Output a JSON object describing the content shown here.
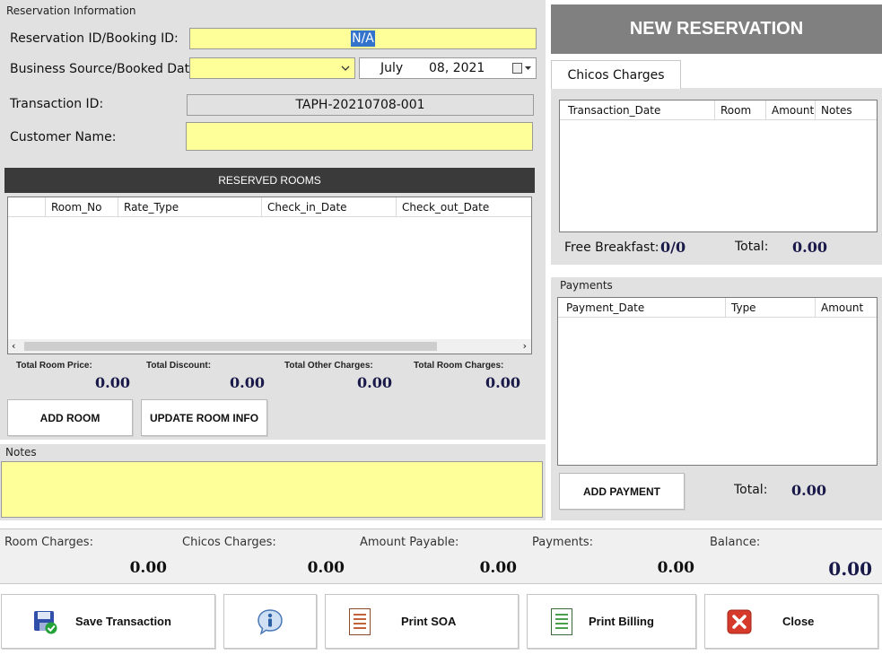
{
  "reservation": {
    "group_label": "Reservation Information",
    "res_id_label": "Reservation ID/Booking ID:",
    "res_id_value": "N/A",
    "source_label": "Business Source/Booked Date:",
    "source_value": "",
    "date_month": "July",
    "date_daytext": "08, 2021",
    "trans_label": "Transaction ID:",
    "trans_value": "TAPH-20210708-001",
    "customer_label": "Customer Name:",
    "customer_value": ""
  },
  "rooms": {
    "header": "RESERVED ROOMS",
    "columns": [
      "Room_No",
      "Rate_Type",
      "Check_in_Date",
      "Check_out_Date"
    ],
    "summary": [
      {
        "label": "Total Room Price:",
        "value": "0.00"
      },
      {
        "label": "Total Discount:",
        "value": "0.00"
      },
      {
        "label": "Total Other Charges:",
        "value": "0.00"
      },
      {
        "label": "Total Room Charges:",
        "value": "0.00"
      }
    ],
    "add_button": "ADD ROOM",
    "update_button": "UPDATE ROOM INFO"
  },
  "notes": {
    "label": "Notes",
    "value": ""
  },
  "title": "NEW RESERVATION",
  "charges": {
    "tab": "Chicos Charges",
    "columns": [
      "Transaction_Date",
      "Room",
      "Amount",
      "Notes"
    ],
    "breakfast_label": "Free Breakfast:",
    "breakfast_value": "0/0",
    "total_label": "Total:",
    "total_value": "0.00"
  },
  "payments": {
    "label": "Payments",
    "columns": [
      "Payment_Date",
      "Type",
      "Amount"
    ],
    "add_button": "ADD PAYMENT",
    "total_label": "Total:",
    "total_value": "0.00"
  },
  "totals": [
    {
      "label": "Room Charges:",
      "value": "0.00"
    },
    {
      "label": "Chicos Charges:",
      "value": "0.00"
    },
    {
      "label": "Amount Payable:",
      "value": "0.00"
    },
    {
      "label": "Payments:",
      "value": "0.00"
    },
    {
      "label": "Balance:",
      "value": "0.00"
    }
  ],
  "actions": {
    "save": "Save Transaction",
    "info_icon": "info-icon",
    "print_soa": "Print SOA",
    "print_billing": "Print Billing",
    "close": "Close"
  },
  "colors": {
    "field_yellow": "#ffff99",
    "header_dark": "#3a3a3a",
    "title_grey": "#808080",
    "panel_grey": "#e1e1e1"
  }
}
